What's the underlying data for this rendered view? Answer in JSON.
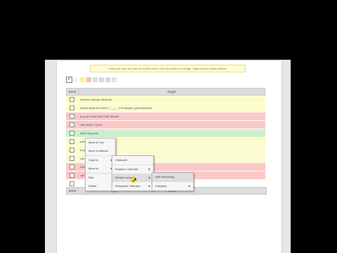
{
  "banner": {
    "text": "Drag and drop the rows to reorder them. Use the menu to manage. Right-click to show options."
  },
  "toolbar": {
    "check_glyph": "✓",
    "swatches": [
      "#f4f4f4",
      "#fbf29a",
      "#f7bcbc",
      "#c6efc6",
      "#f4c8ee",
      "#cfd8f8",
      "#c8eef0"
    ]
  },
  "table": {
    "col_done": "Done",
    "col_target": "Target",
    "rows": [
      {
        "text": "research google adwords",
        "color": "#fbfbcb"
      },
      {
        "text": "review goals list week 1 _____ 6 Employee goal feedback",
        "color": "#fbfbcb"
      },
      {
        "text": "ring up email from Cash Bryant",
        "color": "#fbc8c8"
      },
      {
        "text": "call Jessie Turner",
        "color": "#fbc8c8"
      },
      {
        "text": "write blog post",
        "color": "#cdeecd"
      },
      {
        "text": "write new s...",
        "color": "#fbfbcb"
      },
      {
        "text": "blog...",
        "color": "#fbfbcb"
      },
      {
        "text": "call ... donate Pitchesa Pitt (something)",
        "color": "#fbfbcb"
      },
      {
        "text": "Run...",
        "color": "#fbc8c8"
      },
      {
        "text": "call...",
        "color": "#fbc8c8"
      },
      {
        "text": "",
        "color": "#ffffff"
      }
    ]
  },
  "footer_header": {
    "col_done": "Done",
    "col_target": "Target"
  },
  "context_menu": {
    "items": [
      {
        "label": "Move to Top",
        "arrow": ""
      },
      {
        "label": "Move to Bottom",
        "arrow": ""
      },
      {
        "label": "Copy to",
        "arrow": "►"
      },
      {
        "label": "Move to",
        "arrow": "►"
      },
      {
        "label": "Edit",
        "arrow": ""
      },
      {
        "label": "Delete",
        "arrow": ""
      }
    ]
  },
  "submenu_1": {
    "items": [
      {
        "label": "Clipboard",
        "arrow": ""
      },
      {
        "label": "Dropbox Calendar",
        "arrow": "►"
      },
      {
        "label": "Mental Contexts",
        "arrow": "►"
      },
      {
        "label": "Delegation Statuses",
        "arrow": "►"
      }
    ]
  },
  "submenu_2": {
    "items": [
      {
        "label": "with Reasoning",
        "arrow": ""
      },
      {
        "label": "Category",
        "arrow": "►"
      }
    ]
  }
}
